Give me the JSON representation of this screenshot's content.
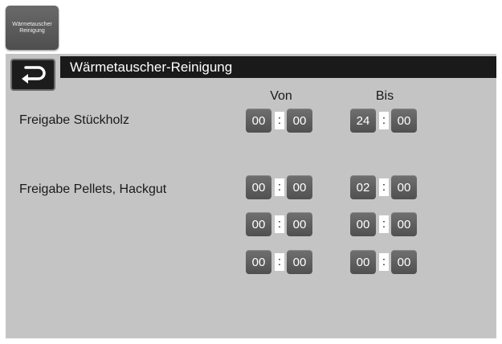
{
  "toolbar": {
    "icon_label": "Wärmetauscher\nReinigung"
  },
  "window": {
    "title": "Wärmetauscher-Reinigung"
  },
  "columns": {
    "from": "Von",
    "to": "Bis"
  },
  "rows": [
    {
      "label": "Freigabe Stückholz"
    },
    {
      "label": "Freigabe Pellets, Hackgut"
    }
  ],
  "separator": ":",
  "times": [
    {
      "from_h": "00",
      "from_m": "00",
      "to_h": "24",
      "to_m": "00"
    },
    {
      "from_h": "00",
      "from_m": "00",
      "to_h": "02",
      "to_m": "00"
    },
    {
      "from_h": "00",
      "from_m": "00",
      "to_h": "00",
      "to_m": "00"
    },
    {
      "from_h": "00",
      "from_m": "00",
      "to_h": "00",
      "to_m": "00"
    }
  ]
}
